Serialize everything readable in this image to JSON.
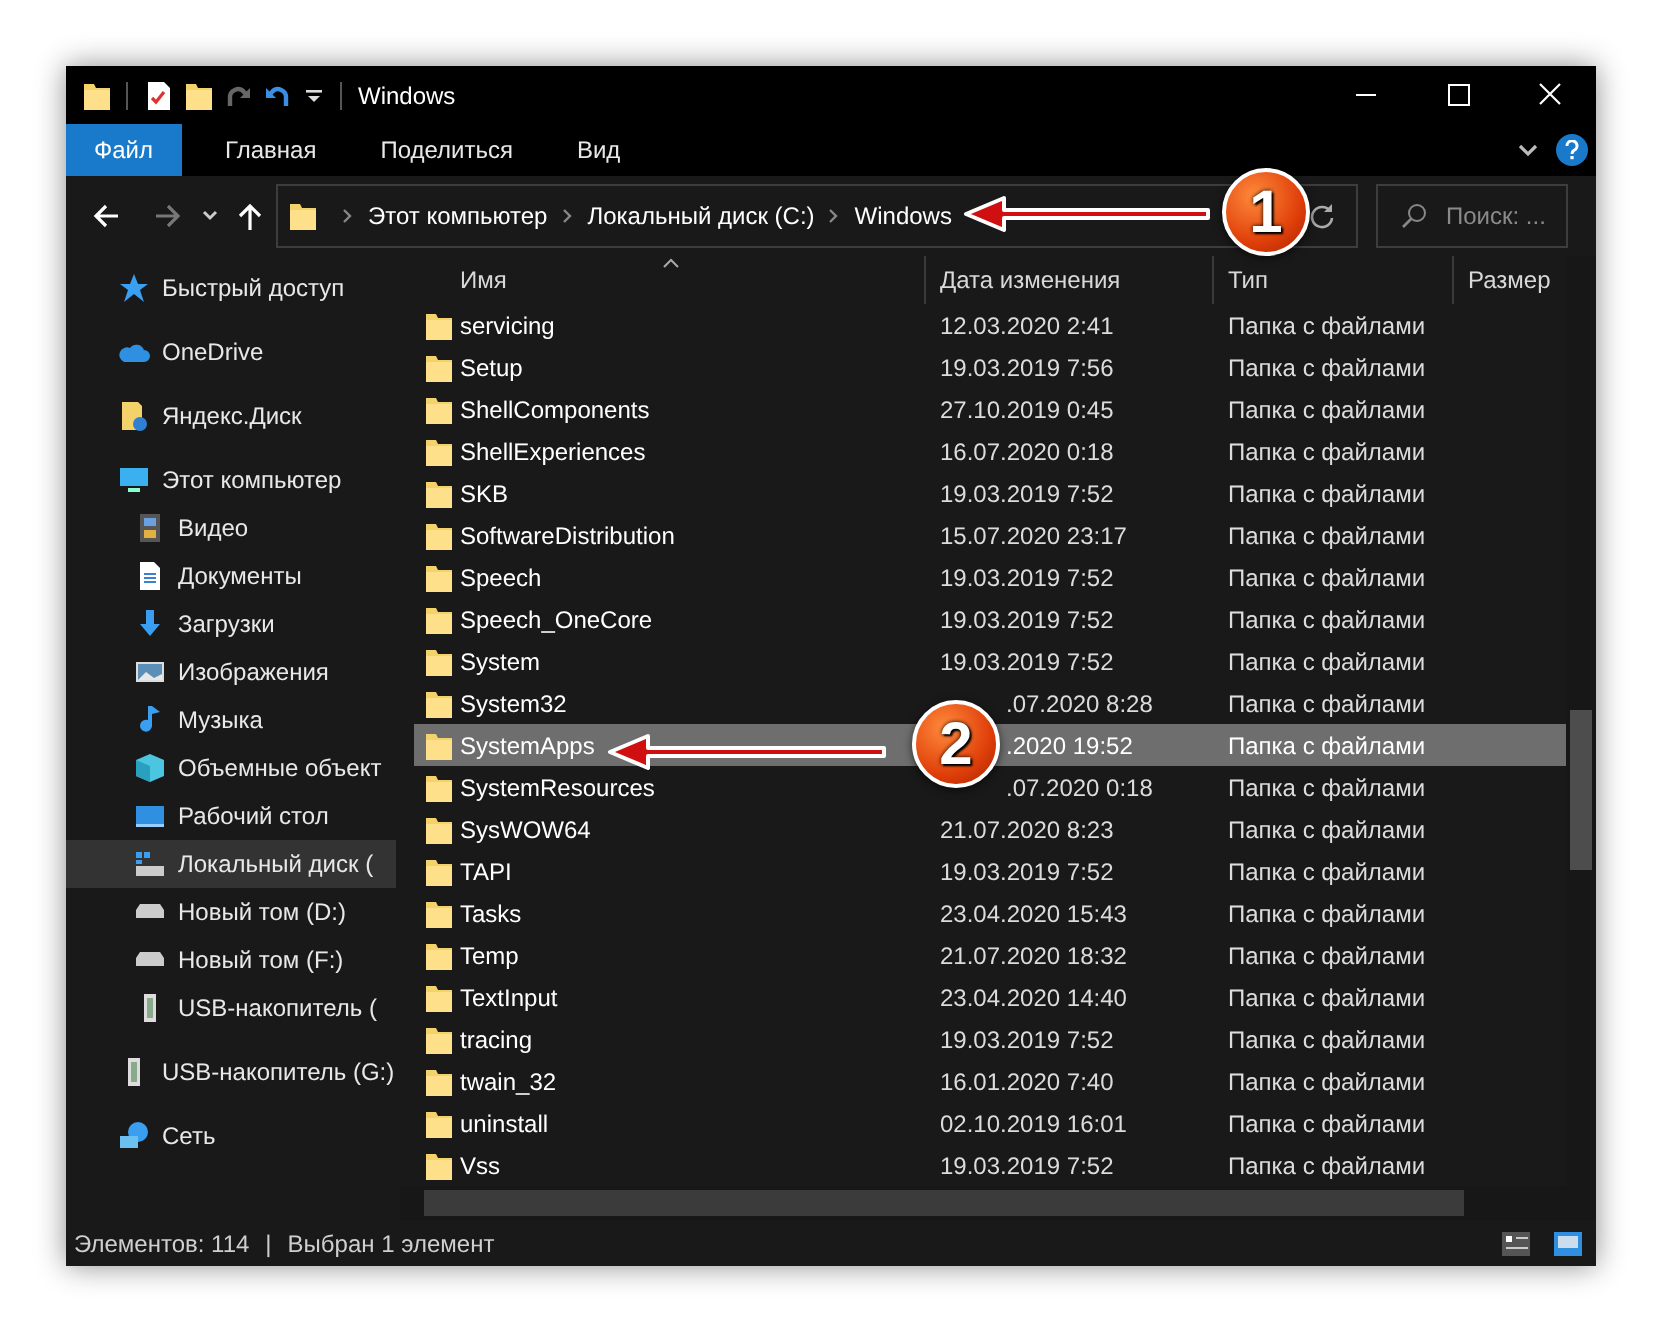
{
  "window": {
    "title": "Windows"
  },
  "ribbon_tabs": [
    {
      "label": "Файл",
      "kind": "file"
    },
    {
      "label": "Главная",
      "kind": "tab"
    },
    {
      "label": "Поделиться",
      "kind": "tab"
    },
    {
      "label": "Вид",
      "kind": "tab"
    }
  ],
  "address": {
    "crumbs": [
      "Этот компьютер",
      "Локальный диск (C:)",
      "Windows"
    ]
  },
  "search": {
    "placeholder": "Поиск: ..."
  },
  "sidebar": {
    "items": [
      {
        "label": "Быстрый доступ",
        "selected": false
      },
      {
        "label": "OneDrive",
        "selected": false
      },
      {
        "label": "Яндекс.Диск",
        "selected": false
      },
      {
        "label": "Этот компьютер",
        "selected": false,
        "children": [
          {
            "label": "Видео",
            "selected": false
          },
          {
            "label": "Документы",
            "selected": false
          },
          {
            "label": "Загрузки",
            "selected": false
          },
          {
            "label": "Изображения",
            "selected": false
          },
          {
            "label": "Музыка",
            "selected": false
          },
          {
            "label": "Объемные объект",
            "selected": false
          },
          {
            "label": "Рабочий стол",
            "selected": false
          },
          {
            "label": "Локальный диск (",
            "selected": true
          },
          {
            "label": "Новый том (D:)",
            "selected": false
          },
          {
            "label": "Новый том (F:)",
            "selected": false
          },
          {
            "label": "USB-накопитель (",
            "selected": false
          }
        ]
      },
      {
        "label": "USB-накопитель (G:)",
        "selected": false
      },
      {
        "label": "Сеть",
        "selected": false
      }
    ]
  },
  "columns": [
    {
      "label": "Имя",
      "sorted": true
    },
    {
      "label": "Дата изменения",
      "sorted": false
    },
    {
      "label": "Тип",
      "sorted": false
    },
    {
      "label": "Размер",
      "sorted": false
    }
  ],
  "rows": [
    {
      "name": "servicing",
      "modified": "12.03.2020 2:41",
      "type": "Папка с файлами",
      "selected": false
    },
    {
      "name": "Setup",
      "modified": "19.03.2019 7:56",
      "type": "Папка с файлами",
      "selected": false
    },
    {
      "name": "ShellComponents",
      "modified": "27.10.2019 0:45",
      "type": "Папка с файлами",
      "selected": false
    },
    {
      "name": "ShellExperiences",
      "modified": "16.07.2020 0:18",
      "type": "Папка с файлами",
      "selected": false
    },
    {
      "name": "SKB",
      "modified": "19.03.2019 7:52",
      "type": "Папка с файлами",
      "selected": false
    },
    {
      "name": "SoftwareDistribution",
      "modified": "15.07.2020 23:17",
      "type": "Папка с файлами",
      "selected": false
    },
    {
      "name": "Speech",
      "modified": "19.03.2019 7:52",
      "type": "Папка с файлами",
      "selected": false
    },
    {
      "name": "Speech_OneCore",
      "modified": "19.03.2019 7:52",
      "type": "Папка с файлами",
      "selected": false
    },
    {
      "name": "System",
      "modified": "19.03.2019 7:52",
      "type": "Папка с файлами",
      "selected": false
    },
    {
      "name": "System32",
      "modified": ".07.2020 8:28",
      "type": "Папка с файлами",
      "selected": false
    },
    {
      "name": "SystemApps",
      "modified": ".2020 19:52",
      "type": "Папка с файлами",
      "selected": true
    },
    {
      "name": "SystemResources",
      "modified": ".07.2020 0:18",
      "type": "Папка с файлами",
      "selected": false
    },
    {
      "name": "SysWOW64",
      "modified": "21.07.2020 8:23",
      "type": "Папка с файлами",
      "selected": false
    },
    {
      "name": "TAPI",
      "modified": "19.03.2019 7:52",
      "type": "Папка с файлами",
      "selected": false
    },
    {
      "name": "Tasks",
      "modified": "23.04.2020 15:43",
      "type": "Папка с файлами",
      "selected": false
    },
    {
      "name": "Temp",
      "modified": "21.07.2020 18:32",
      "type": "Папка с файлами",
      "selected": false
    },
    {
      "name": "TextInput",
      "modified": "23.04.2020 14:40",
      "type": "Папка с файлами",
      "selected": false
    },
    {
      "name": "tracing",
      "modified": "19.03.2019 7:52",
      "type": "Папка с файлами",
      "selected": false
    },
    {
      "name": "twain_32",
      "modified": "16.01.2020 7:40",
      "type": "Папка с файлами",
      "selected": false
    },
    {
      "name": "uninstall",
      "modified": "02.10.2019 16:01",
      "type": "Папка с файлами",
      "selected": false
    },
    {
      "name": "Vss",
      "modified": "19.03.2019 7:52",
      "type": "Папка с файлами",
      "selected": false
    }
  ],
  "status_bar": {
    "item_count": "Элементов: 114",
    "separator": "|",
    "selection": "Выбран 1 элемент"
  },
  "callouts": [
    {
      "number": "1"
    },
    {
      "number": "2"
    }
  ]
}
